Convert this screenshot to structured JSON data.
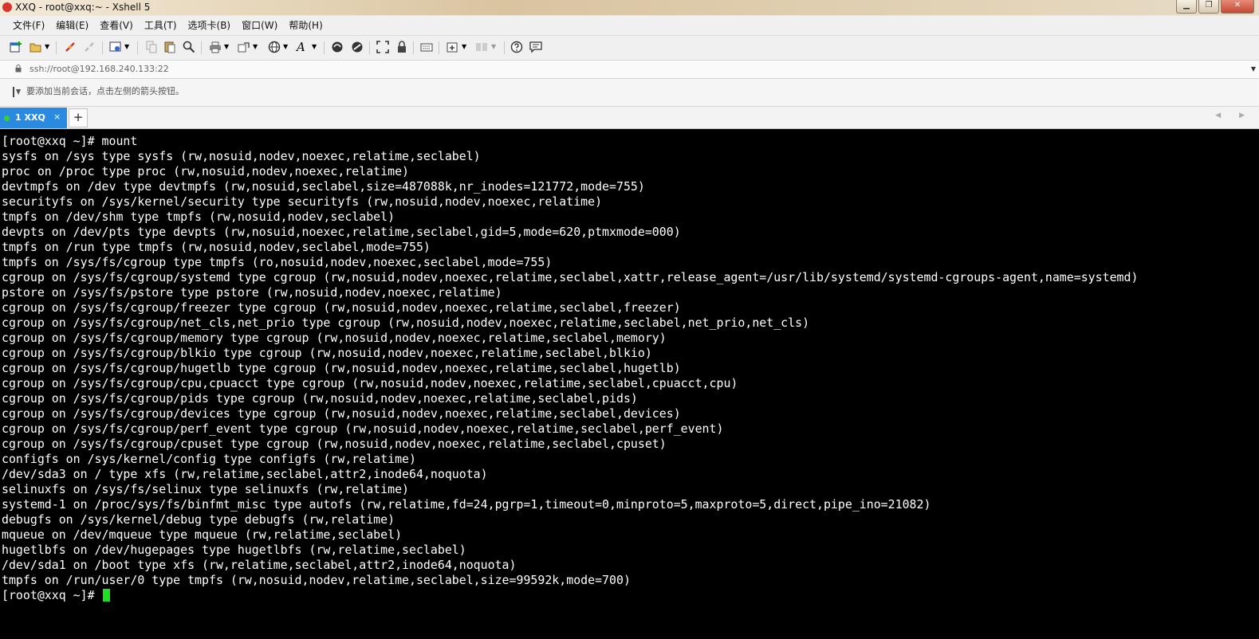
{
  "window": {
    "title": "XXQ - root@xxq:~ - Xshell 5",
    "minimize_label": "▁",
    "restore_label": "❐",
    "close_label": "✕"
  },
  "menu": [
    "文件(F)",
    "编辑(E)",
    "查看(V)",
    "工具(T)",
    "选项卡(B)",
    "窗口(W)",
    "帮助(H)"
  ],
  "toolbar": {
    "icons": [
      "new-session-icon",
      "open-folder-icon",
      "connect-icon",
      "disconnect-icon",
      "properties-icon",
      "copy-icon",
      "paste-icon",
      "find-icon",
      "print-icon",
      "transfer-icon",
      "globe-icon",
      "font-icon",
      "xftp-icon",
      "xmanager-icon",
      "fullscreen-icon",
      "lock-icon",
      "keyboard-icon",
      "new-tab-icon",
      "layout-icon",
      "help-icon",
      "chat-icon"
    ]
  },
  "address": {
    "text": "ssh://root@192.168.240.133:22"
  },
  "hint": {
    "text": "要添加当前会话，点击左侧的箭头按钮。"
  },
  "tabs": [
    {
      "label": "1 XXQ",
      "close": "×",
      "status": "connected"
    }
  ],
  "tab_add_label": "+",
  "tab_nav_label": "◀ ▶",
  "terminal": {
    "lines": [
      "[root@xxq ~]# mount",
      "sysfs on /sys type sysfs (rw,nosuid,nodev,noexec,relatime,seclabel)",
      "proc on /proc type proc (rw,nosuid,nodev,noexec,relatime)",
      "devtmpfs on /dev type devtmpfs (rw,nosuid,seclabel,size=487088k,nr_inodes=121772,mode=755)",
      "securityfs on /sys/kernel/security type securityfs (rw,nosuid,nodev,noexec,relatime)",
      "tmpfs on /dev/shm type tmpfs (rw,nosuid,nodev,seclabel)",
      "devpts on /dev/pts type devpts (rw,nosuid,noexec,relatime,seclabel,gid=5,mode=620,ptmxmode=000)",
      "tmpfs on /run type tmpfs (rw,nosuid,nodev,seclabel,mode=755)",
      "tmpfs on /sys/fs/cgroup type tmpfs (ro,nosuid,nodev,noexec,seclabel,mode=755)",
      "cgroup on /sys/fs/cgroup/systemd type cgroup (rw,nosuid,nodev,noexec,relatime,seclabel,xattr,release_agent=/usr/lib/systemd/systemd-cgroups-agent,name=systemd)",
      "pstore on /sys/fs/pstore type pstore (rw,nosuid,nodev,noexec,relatime)",
      "cgroup on /sys/fs/cgroup/freezer type cgroup (rw,nosuid,nodev,noexec,relatime,seclabel,freezer)",
      "cgroup on /sys/fs/cgroup/net_cls,net_prio type cgroup (rw,nosuid,nodev,noexec,relatime,seclabel,net_prio,net_cls)",
      "cgroup on /sys/fs/cgroup/memory type cgroup (rw,nosuid,nodev,noexec,relatime,seclabel,memory)",
      "cgroup on /sys/fs/cgroup/blkio type cgroup (rw,nosuid,nodev,noexec,relatime,seclabel,blkio)",
      "cgroup on /sys/fs/cgroup/hugetlb type cgroup (rw,nosuid,nodev,noexec,relatime,seclabel,hugetlb)",
      "cgroup on /sys/fs/cgroup/cpu,cpuacct type cgroup (rw,nosuid,nodev,noexec,relatime,seclabel,cpuacct,cpu)",
      "cgroup on /sys/fs/cgroup/pids type cgroup (rw,nosuid,nodev,noexec,relatime,seclabel,pids)",
      "cgroup on /sys/fs/cgroup/devices type cgroup (rw,nosuid,nodev,noexec,relatime,seclabel,devices)",
      "cgroup on /sys/fs/cgroup/perf_event type cgroup (rw,nosuid,nodev,noexec,relatime,seclabel,perf_event)",
      "cgroup on /sys/fs/cgroup/cpuset type cgroup (rw,nosuid,nodev,noexec,relatime,seclabel,cpuset)",
      "configfs on /sys/kernel/config type configfs (rw,relatime)",
      "/dev/sda3 on / type xfs (rw,relatime,seclabel,attr2,inode64,noquota)",
      "selinuxfs on /sys/fs/selinux type selinuxfs (rw,relatime)",
      "systemd-1 on /proc/sys/fs/binfmt_misc type autofs (rw,relatime,fd=24,pgrp=1,timeout=0,minproto=5,maxproto=5,direct,pipe_ino=21082)",
      "debugfs on /sys/kernel/debug type debugfs (rw,relatime)",
      "mqueue on /dev/mqueue type mqueue (rw,relatime,seclabel)",
      "hugetlbfs on /dev/hugepages type hugetlbfs (rw,relatime,seclabel)",
      "/dev/sda1 on /boot type xfs (rw,relatime,seclabel,attr2,inode64,noquota)",
      "tmpfs on /run/user/0 type tmpfs (rw,nosuid,nodev,relatime,seclabel,size=99592k,mode=700)"
    ],
    "prompt": "[root@xxq ~]# ",
    "colors": {
      "background": "#000000",
      "foreground": "#ffffff",
      "cursor": "#1fe01f"
    }
  },
  "colors": {
    "tab_active": "#2a8ae0",
    "tab_status_dot": "#39d12a",
    "close_button": "#c44733"
  }
}
